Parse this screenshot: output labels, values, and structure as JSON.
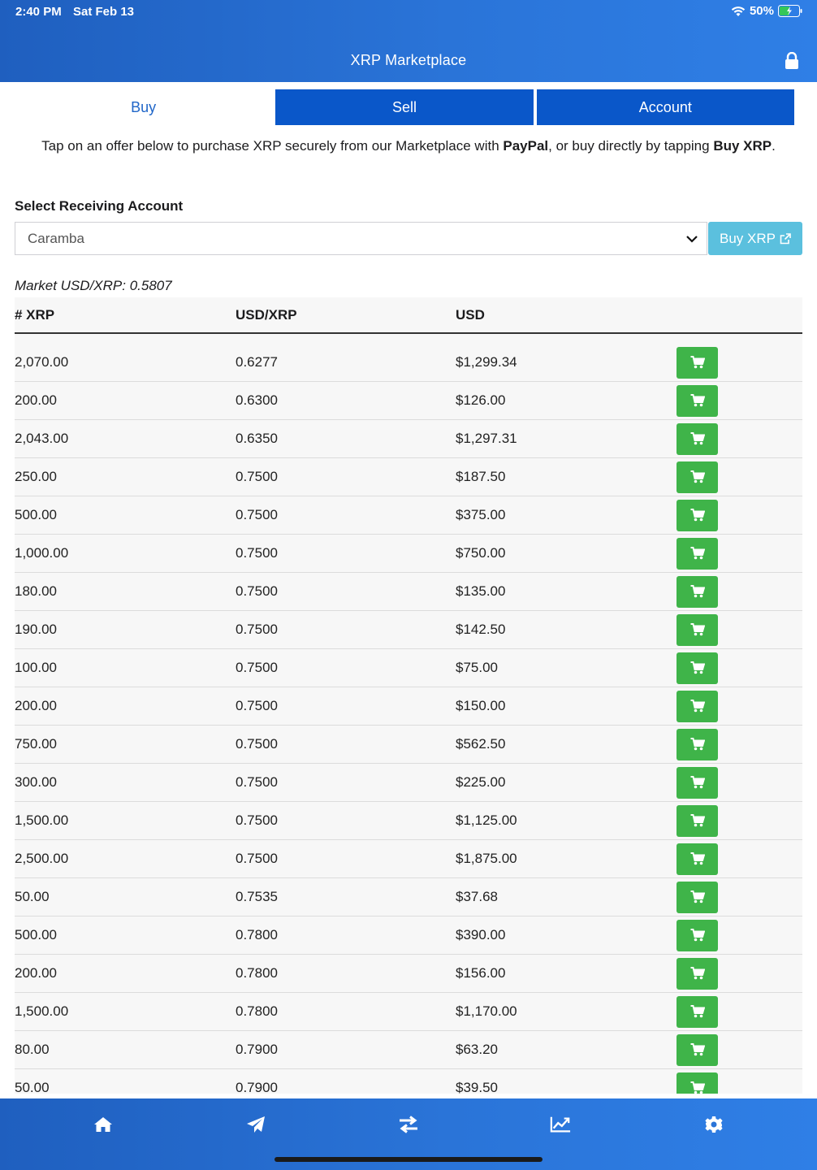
{
  "status": {
    "time": "2:40 PM",
    "date": "Sat Feb 13",
    "battery": "50%"
  },
  "header": {
    "title": "XRP Marketplace"
  },
  "tabs": [
    {
      "label": "Buy"
    },
    {
      "label": "Sell"
    },
    {
      "label": "Account"
    }
  ],
  "intro": {
    "part1": "Tap on an offer below to purchase XRP securely from our Marketplace with ",
    "paypal": "PayPal",
    "part2": ", or buy directly by tapping ",
    "buyxrp": "Buy XRP",
    "part3": "."
  },
  "receiving": {
    "label": "Select Receiving Account",
    "selected": "Caramba",
    "button": "Buy XRP"
  },
  "market": "Market USD/XRP: 0.5807",
  "table": {
    "headers": [
      "# XRP",
      "USD/XRP",
      "USD",
      ""
    ],
    "rows": [
      [
        "2,070.00",
        "0.6277",
        "$1,299.34"
      ],
      [
        "200.00",
        "0.6300",
        "$126.00"
      ],
      [
        "2,043.00",
        "0.6350",
        "$1,297.31"
      ],
      [
        "250.00",
        "0.7500",
        "$187.50"
      ],
      [
        "500.00",
        "0.7500",
        "$375.00"
      ],
      [
        "1,000.00",
        "0.7500",
        "$750.00"
      ],
      [
        "180.00",
        "0.7500",
        "$135.00"
      ],
      [
        "190.00",
        "0.7500",
        "$142.50"
      ],
      [
        "100.00",
        "0.7500",
        "$75.00"
      ],
      [
        "200.00",
        "0.7500",
        "$150.00"
      ],
      [
        "750.00",
        "0.7500",
        "$562.50"
      ],
      [
        "300.00",
        "0.7500",
        "$225.00"
      ],
      [
        "1,500.00",
        "0.7500",
        "$1,125.00"
      ],
      [
        "2,500.00",
        "0.7500",
        "$1,875.00"
      ],
      [
        "50.00",
        "0.7535",
        "$37.68"
      ],
      [
        "500.00",
        "0.7800",
        "$390.00"
      ],
      [
        "200.00",
        "0.7800",
        "$156.00"
      ],
      [
        "1,500.00",
        "0.7800",
        "$1,170.00"
      ],
      [
        "80.00",
        "0.7900",
        "$63.20"
      ],
      [
        "50.00",
        "0.7900",
        "$39.50"
      ]
    ]
  },
  "nav": [
    "home-icon",
    "send-icon",
    "exchange-icon",
    "chart-icon",
    "settings-icon"
  ]
}
